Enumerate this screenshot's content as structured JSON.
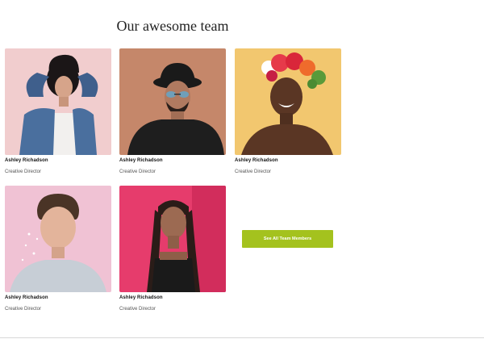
{
  "section": {
    "title": "Our awesome team",
    "cta_label": "See All Team Members",
    "accent_color": "#a4c21e"
  },
  "members": [
    {
      "name": "Ashley Richadson",
      "role": "Creative Director",
      "photo": "woman-denim-jacket"
    },
    {
      "name": "Ashley Richadson",
      "role": "Creative Director",
      "photo": "man-black-hat-sunglasses"
    },
    {
      "name": "Ashley Richadson",
      "role": "Creative Director",
      "photo": "woman-flower-crown"
    },
    {
      "name": "Ashley Richadson",
      "role": "Creative Director",
      "photo": "man-glitter-face"
    },
    {
      "name": "Ashley Richadson",
      "role": "Creative Director",
      "photo": "woman-braids-pink-wall"
    }
  ]
}
